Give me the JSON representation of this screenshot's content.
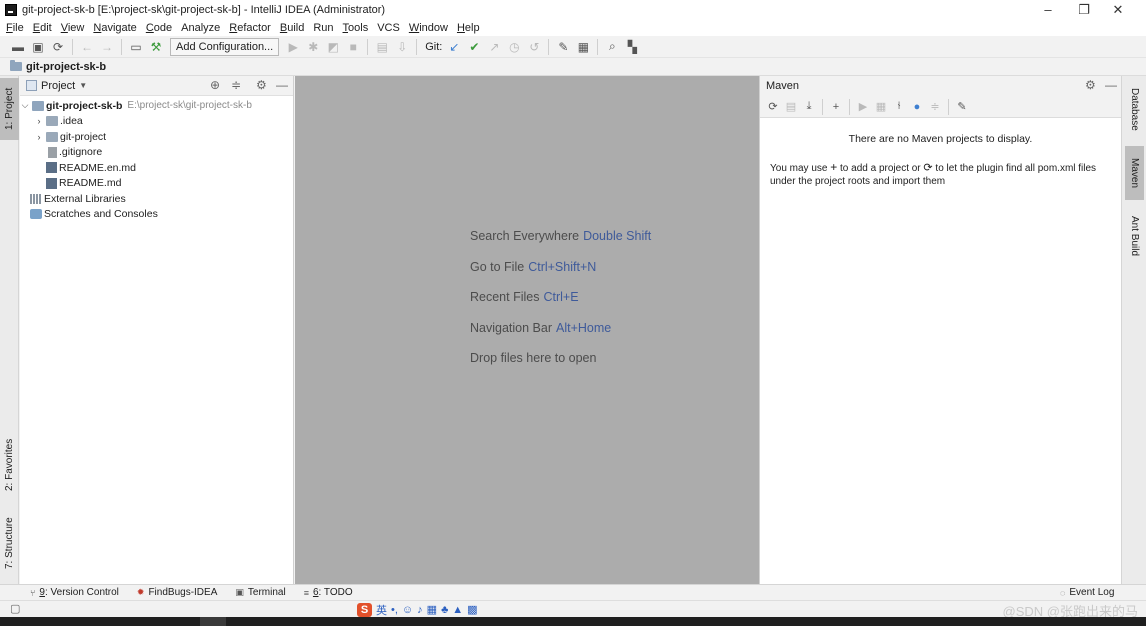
{
  "window": {
    "title": "git-project-sk-b [E:\\project-sk\\git-project-sk-b] - IntelliJ IDEA (Administrator)",
    "controls": [
      "–",
      "❐",
      "✕"
    ]
  },
  "menubar": {
    "items": [
      {
        "u": "F",
        "rest": "ile"
      },
      {
        "u": "E",
        "rest": "dit"
      },
      {
        "u": "V",
        "rest": "iew"
      },
      {
        "u": "N",
        "rest": "avigate",
        "pre": ""
      },
      {
        "u": "C",
        "rest": "ode"
      },
      {
        "u": "",
        "rest": "Analyze"
      },
      {
        "u": "R",
        "rest": "efactor"
      },
      {
        "u": "B",
        "rest": "uild"
      },
      {
        "u": "",
        "rest": "Run"
      },
      {
        "u": "T",
        "rest": "ools"
      },
      {
        "u": "",
        "rest": "VCS"
      },
      {
        "u": "W",
        "rest": "indow"
      },
      {
        "u": "H",
        "rest": "elp"
      }
    ]
  },
  "toolbar": {
    "add_configuration": "Add Configuration...",
    "git_label": "Git:"
  },
  "breadcrumb": {
    "project": "git-project-sk-b"
  },
  "left_stripe": {
    "project_tab": "1: Project",
    "favorites_tab": "2: Favorites",
    "structure_tab": "7: Structure"
  },
  "right_stripe": {
    "database_tab": "Database",
    "maven_tab": "Maven",
    "ant_tab": "Ant Build"
  },
  "project_panel": {
    "title": "Project",
    "tree": {
      "root_name": "git-project-sk-b",
      "root_path": "E:\\project-sk\\git-project-sk-b",
      "idea": ".idea",
      "git_project": "git-project",
      "gitignore": ".gitignore",
      "readme_en": "README.en.md",
      "readme": "README.md",
      "external_libraries": "External Libraries",
      "scratches": "Scratches and Consoles"
    }
  },
  "editor": {
    "hints": [
      {
        "label": "Search Everywhere",
        "shortcut": "Double Shift"
      },
      {
        "label": "Go to File",
        "shortcut": "Ctrl+Shift+N"
      },
      {
        "label": "Recent Files",
        "shortcut": "Ctrl+E"
      },
      {
        "label": "Navigation Bar",
        "shortcut": "Alt+Home"
      },
      {
        "label": "Drop files here to open",
        "shortcut": ""
      }
    ]
  },
  "maven": {
    "title": "Maven",
    "empty_message": "There are no Maven projects to display.",
    "hint_line1_a": "You may use",
    "hint_line1_b": "to add a project or",
    "hint_line1_c": "to let the plugin find all pom.xml files",
    "hint_line2": "under the project roots and import them"
  },
  "bottom_bar": {
    "version_control": {
      "u": "9",
      "rest": ": Version Control"
    },
    "findbugs": "FindBugs-IDEA",
    "terminal": "Terminal",
    "todo": {
      "u": "6",
      "rest": ": TODO"
    },
    "event_log": "Event Log"
  },
  "status_bar": {
    "ime_logo": "S",
    "ime_lang": "英",
    "watermark": "@SDN @张跑出来的马"
  }
}
